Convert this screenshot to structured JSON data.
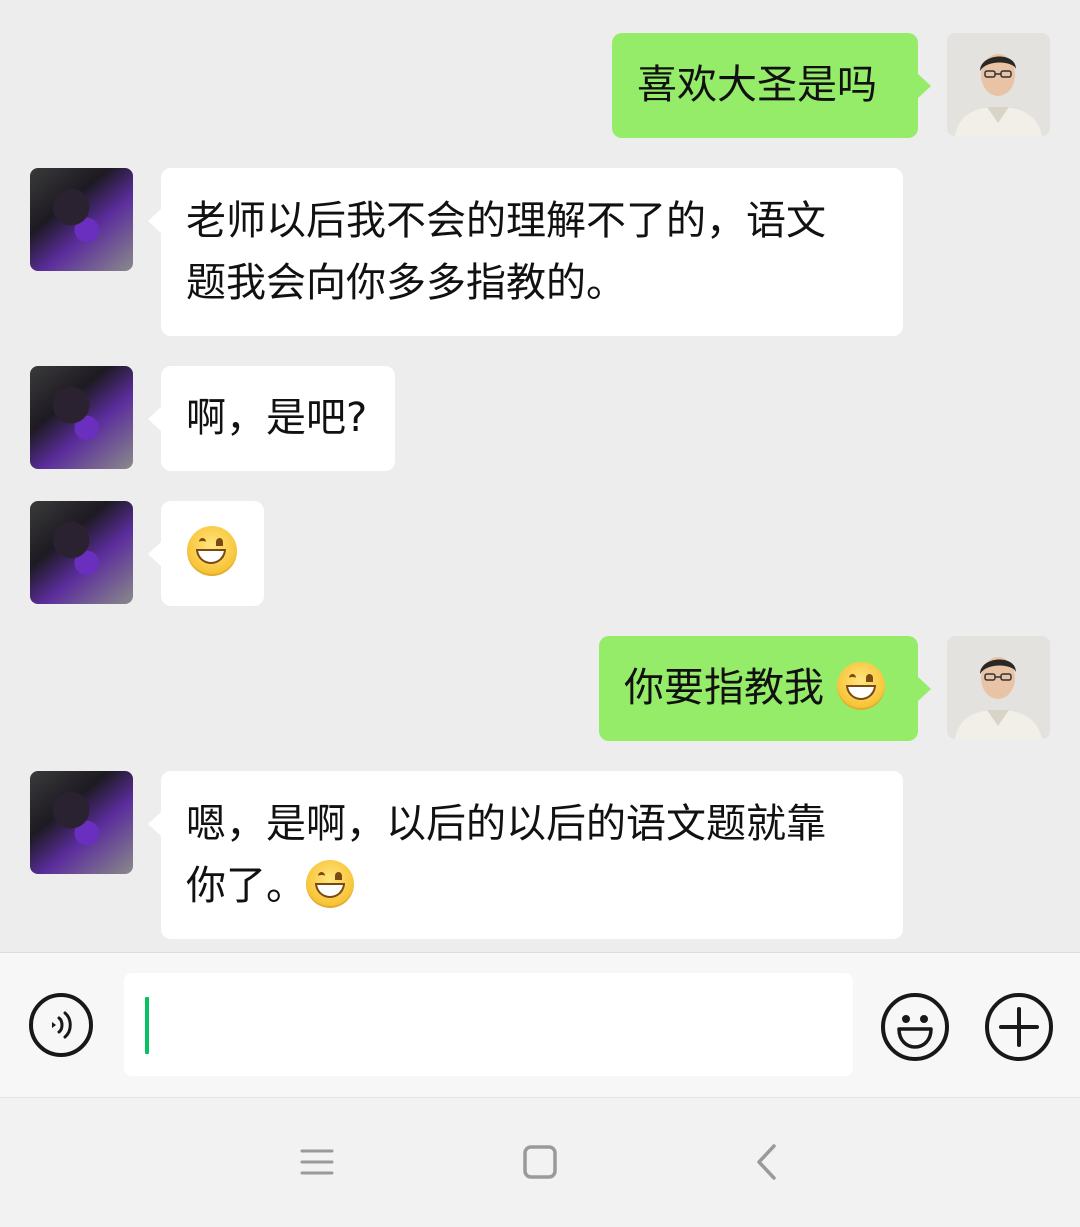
{
  "messages": [
    {
      "sender": "self",
      "lines": [
        "喜欢大圣是吗"
      ]
    },
    {
      "sender": "other",
      "lines": [
        "老师以后我不会的理解不了的，语文",
        "题我会向你多多指教的。"
      ]
    },
    {
      "sender": "other",
      "lines": [
        "啊，是吧?"
      ]
    },
    {
      "sender": "other",
      "emoji": "grinning-face-emoji"
    },
    {
      "sender": "self",
      "text": "你要指教我",
      "emoji": "grinning-face-emoji"
    },
    {
      "sender": "other",
      "lines": [
        "嗯，是啊，以后的以后的语文题就靠",
        "你了。"
      ],
      "emoji": "grinning-face-emoji"
    }
  ],
  "input": {
    "value": "",
    "voice_icon": "voice-input-icon",
    "emoji_icon": "emoji-icon",
    "more_icon": "plus-icon"
  },
  "nav": {
    "menu_icon": "menu-icon",
    "home_icon": "home-icon",
    "back_icon": "back-icon"
  },
  "colors": {
    "self_bubble": "#95ec69",
    "other_bubble": "#ffffff",
    "chat_background": "#ededed",
    "caret": "#07c160"
  }
}
